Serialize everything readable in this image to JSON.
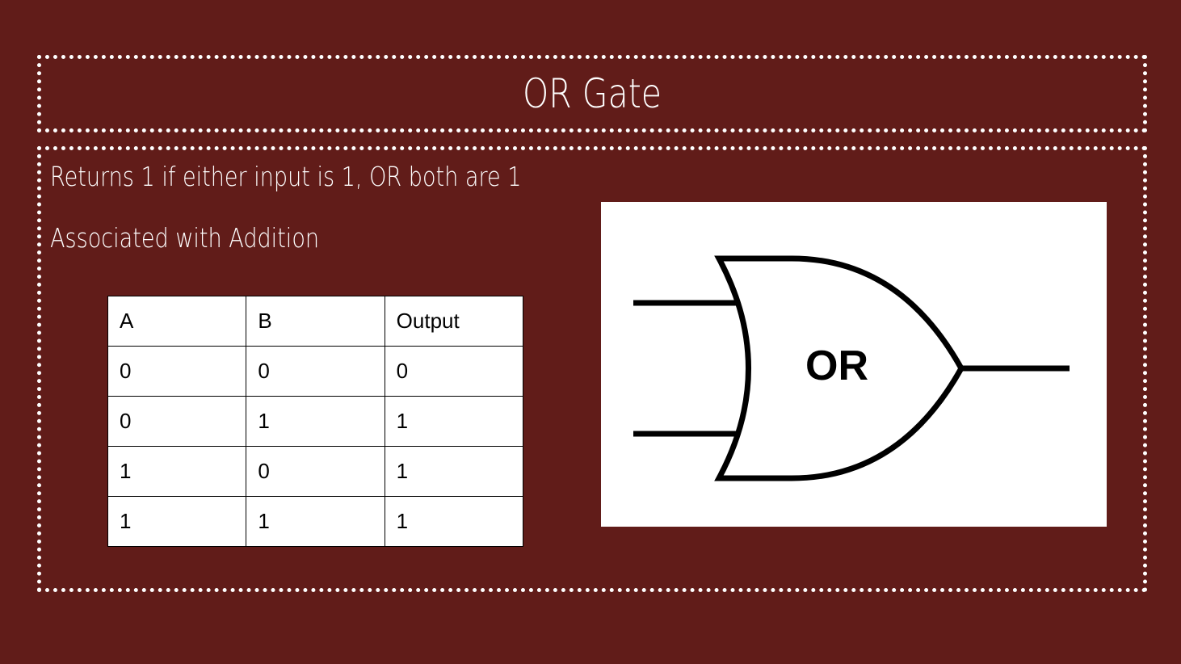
{
  "slide": {
    "title": "OR Gate",
    "lines": [
      "Returns 1 if either input is 1, OR both are 1",
      "Associated with Addition"
    ]
  },
  "truth_table": {
    "headers": [
      "A",
      "B",
      "Output"
    ],
    "rows": [
      [
        "0",
        "0",
        "0"
      ],
      [
        "0",
        "1",
        "1"
      ],
      [
        "1",
        "0",
        "1"
      ],
      [
        "1",
        "1",
        "1"
      ]
    ]
  },
  "gate": {
    "label": "OR"
  },
  "colors": {
    "background": "#611c19",
    "border": "#ffffff",
    "text": "#ffffff"
  }
}
